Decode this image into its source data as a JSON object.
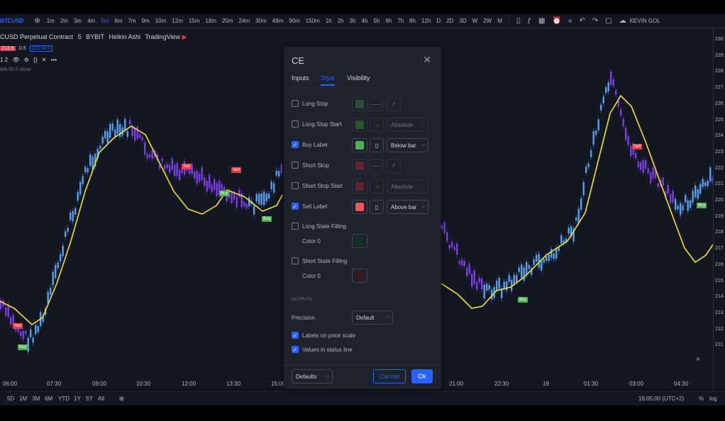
{
  "toolbar": {
    "symbol": "BTCUSD",
    "timeframes": [
      "1m",
      "2m",
      "3m",
      "4m",
      "5m",
      "6m",
      "7m",
      "9m",
      "10m",
      "12m",
      "15m",
      "18m",
      "20m",
      "24m",
      "30m",
      "48m",
      "90m",
      "150m",
      "1h",
      "2h",
      "3h",
      "4h",
      "5h",
      "6h",
      "7h",
      "8h",
      "12h",
      "D",
      "2D",
      "3D",
      "W",
      "2W",
      "M"
    ],
    "active_timeframe": "5m",
    "user": "KEVIN GOL"
  },
  "legend": {
    "title": "CUSD Perpetual Contract",
    "interval": "5",
    "exchange": "BYBIT",
    "chart_type": "Heikin Ashi",
    "source": "TradingView",
    "bid": "213.5",
    "spread": "0.5",
    "ask": "22214.0",
    "indicator_count": "1 2",
    "ma_label": "MA 50 0 close"
  },
  "chart_labels": {
    "sell": "Sell",
    "buy": "Buy"
  },
  "time_axis": [
    "06:00",
    "07:30",
    "09:00",
    "10:30",
    "12:00",
    "13:30",
    "15:00",
    "21:00",
    "22:30",
    "19",
    "01:30",
    "03:00",
    "04:30"
  ],
  "price_scale": [
    "230",
    "229",
    "228",
    "227",
    "226",
    "225",
    "224",
    "223",
    "222",
    "221",
    "220",
    "219",
    "218",
    "217",
    "216",
    "215",
    "214",
    "213",
    "212",
    "211"
  ],
  "bottom_bar": {
    "ranges": [
      "5D",
      "1M",
      "3M",
      "6M",
      "YTD",
      "1Y",
      "5Y",
      "All"
    ],
    "time": "16:05:00 (UTC+2)",
    "percent": "%",
    "log": "log"
  },
  "dialog": {
    "title": "CE",
    "tabs": [
      "Inputs",
      "Style",
      "Visibility"
    ],
    "active_tab": "Style",
    "rows": [
      {
        "label": "Long Stop",
        "checked": false,
        "color": "#388e3c",
        "type": "line"
      },
      {
        "label": "Long Stop Start",
        "checked": false,
        "color": "#388e3c",
        "type": "shape",
        "select": "Absolute"
      },
      {
        "label": "Buy Label",
        "checked": true,
        "color": "#4caf50",
        "type": "label",
        "select": "Below bar"
      },
      {
        "label": "Short Stop",
        "checked": false,
        "color": "#b22833",
        "type": "line"
      },
      {
        "label": "Short Stop Start",
        "checked": false,
        "color": "#b22833",
        "type": "shape",
        "select": "Absolute"
      },
      {
        "label": "Sell Label",
        "checked": true,
        "color": "#f7525f",
        "type": "label",
        "select": "Above bar"
      }
    ],
    "long_fill": {
      "label": "Long State Filling",
      "color_label": "Color 0"
    },
    "short_fill": {
      "label": "Short State Filling",
      "color_label": "Color 0"
    },
    "outputs_header": "OUTPUTS",
    "precision_label": "Precision",
    "precision_value": "Default",
    "labels_on_scale": "Labels on price scale",
    "values_in_status": "Values in status line",
    "defaults_label": "Defaults",
    "cancel_label": "Cancel",
    "ok_label": "Ok",
    "accent": "#2962ff"
  }
}
